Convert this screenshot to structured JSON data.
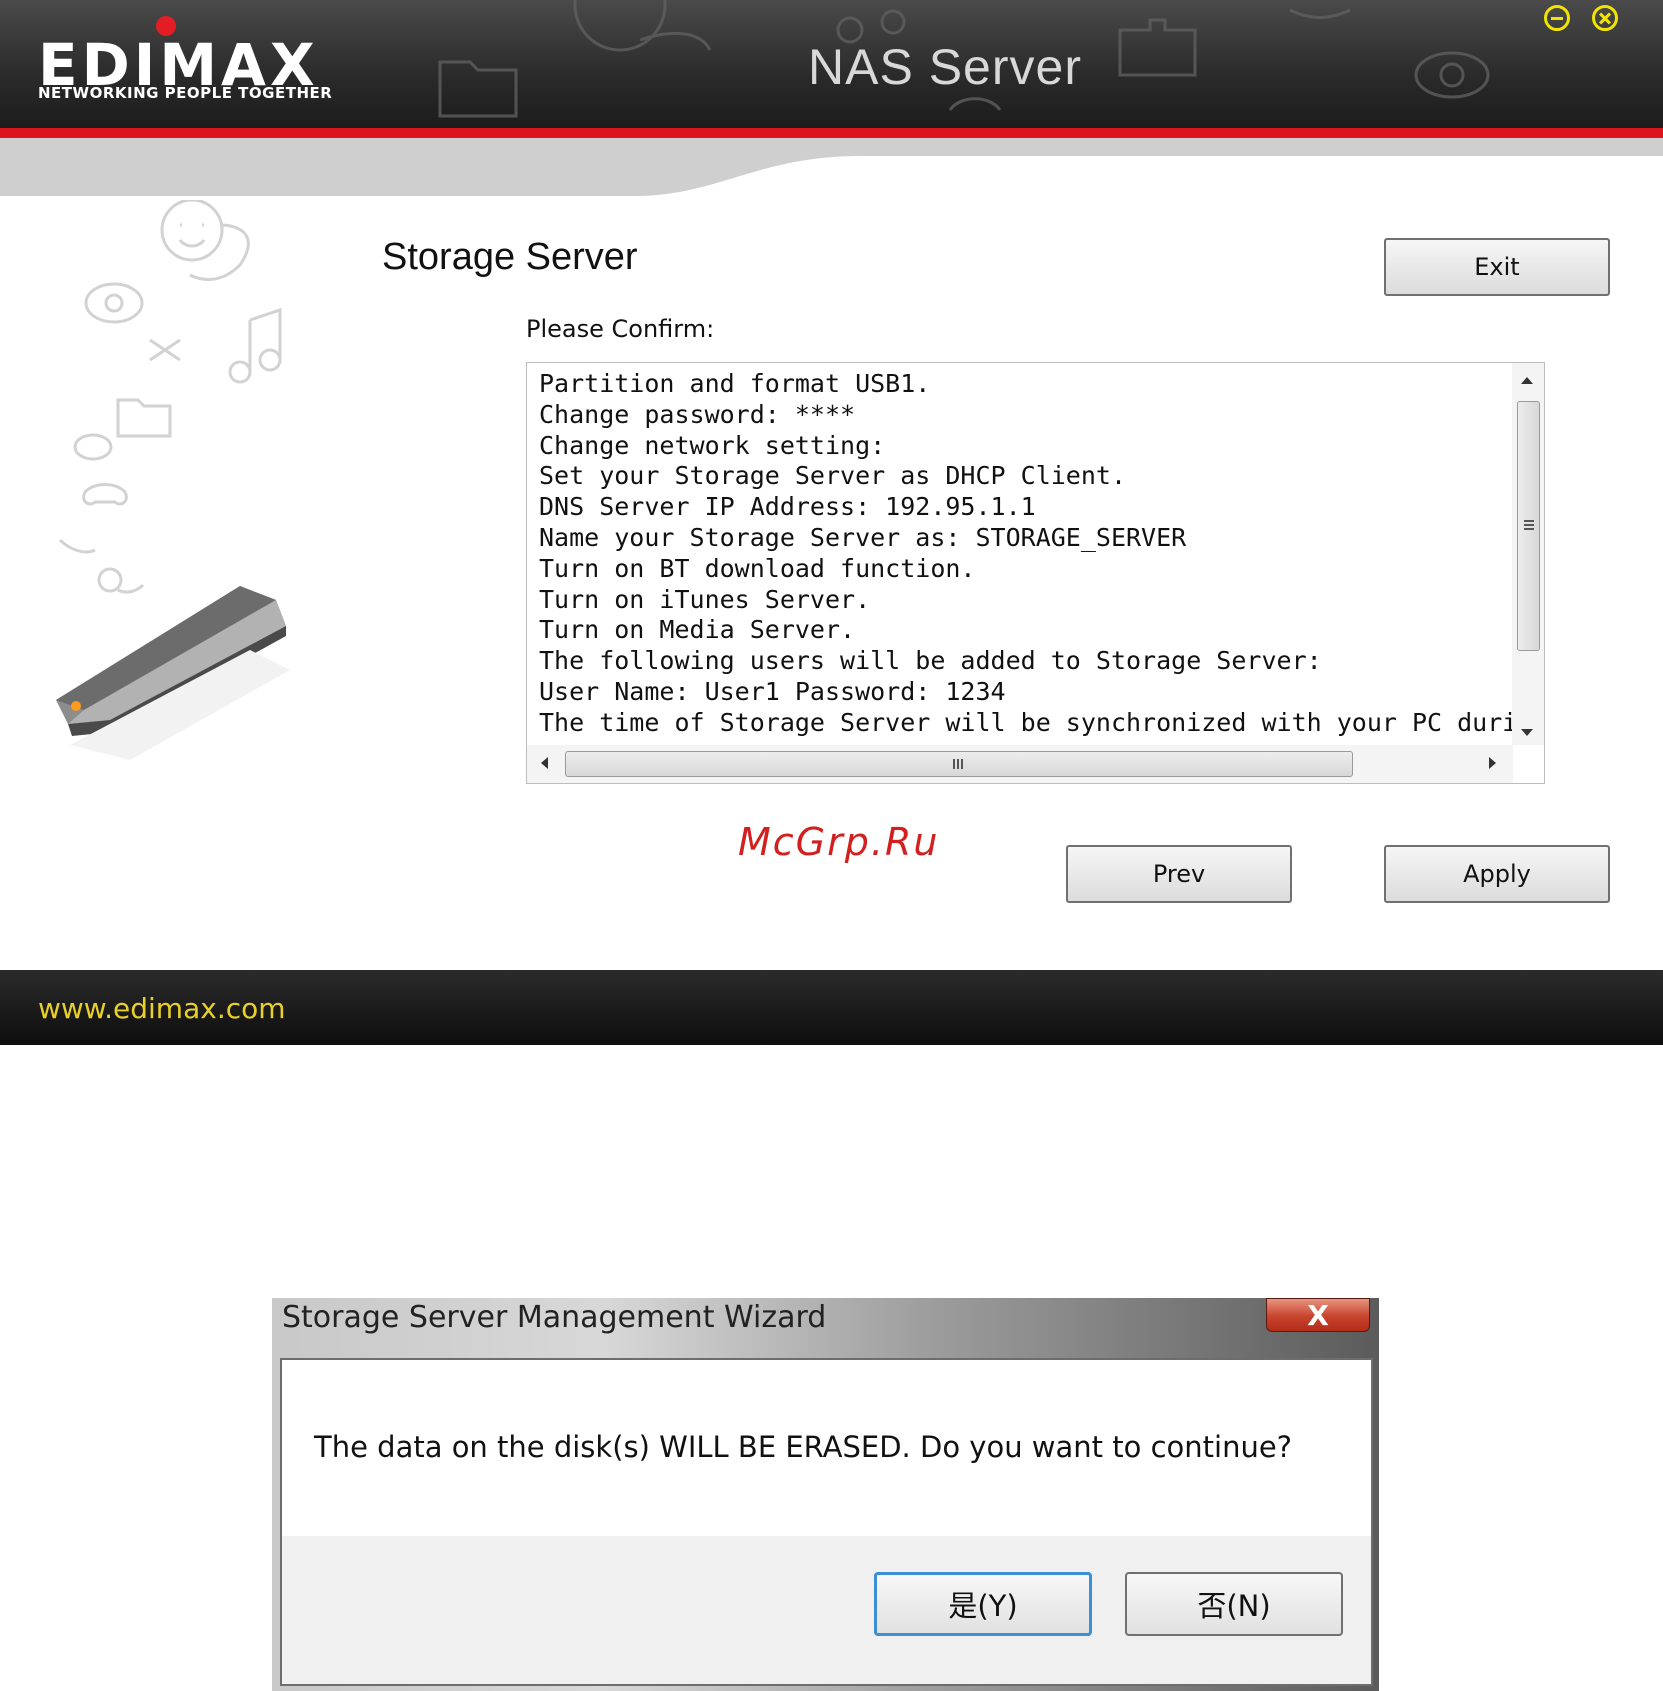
{
  "window": {
    "logo_text": "EDIMAX",
    "logo_tagline": "NETWORKING PEOPLE TOGETHER",
    "app_title": "NAS Server",
    "controls": {
      "minimize_icon": "minimize-icon",
      "close_icon": "close-icon",
      "accent": "#f2e400"
    }
  },
  "main": {
    "page_title": "Storage Server",
    "exit_label": "Exit",
    "confirm_label": "Please Confirm:",
    "confirm_lines": [
      "Partition and format USB1.",
      "Change password: ****",
      "Change network setting:",
      "Set your Storage Server as DHCP Client.",
      "DNS Server IP Address: 192.95.1.1",
      "Name your Storage Server as: STORAGE_SERVER",
      "Turn on BT download function.",
      "Turn on iTunes Server.",
      "Turn on Media Server.",
      "The following users will be added to Storage Server:",
      "User Name: User1 Password: 1234",
      "The time of Storage Server will be synchronized with your PC during this co"
    ],
    "prev_label": "Prev",
    "apply_label": "Apply",
    "watermark": "McGrp.Ru"
  },
  "footer": {
    "url": "www.edimax.com"
  },
  "dialog": {
    "title": "Storage Server Management Wizard",
    "close_label": "X",
    "message": "The data on the disk(s) WILL BE ERASED. Do you want to continue?",
    "yes_label": "是(Y)",
    "no_label": "否(N)"
  },
  "colors": {
    "brand_red": "#d9141b",
    "footer_text": "#e8cf2a",
    "dialog_default_border": "#3c8fd4"
  }
}
